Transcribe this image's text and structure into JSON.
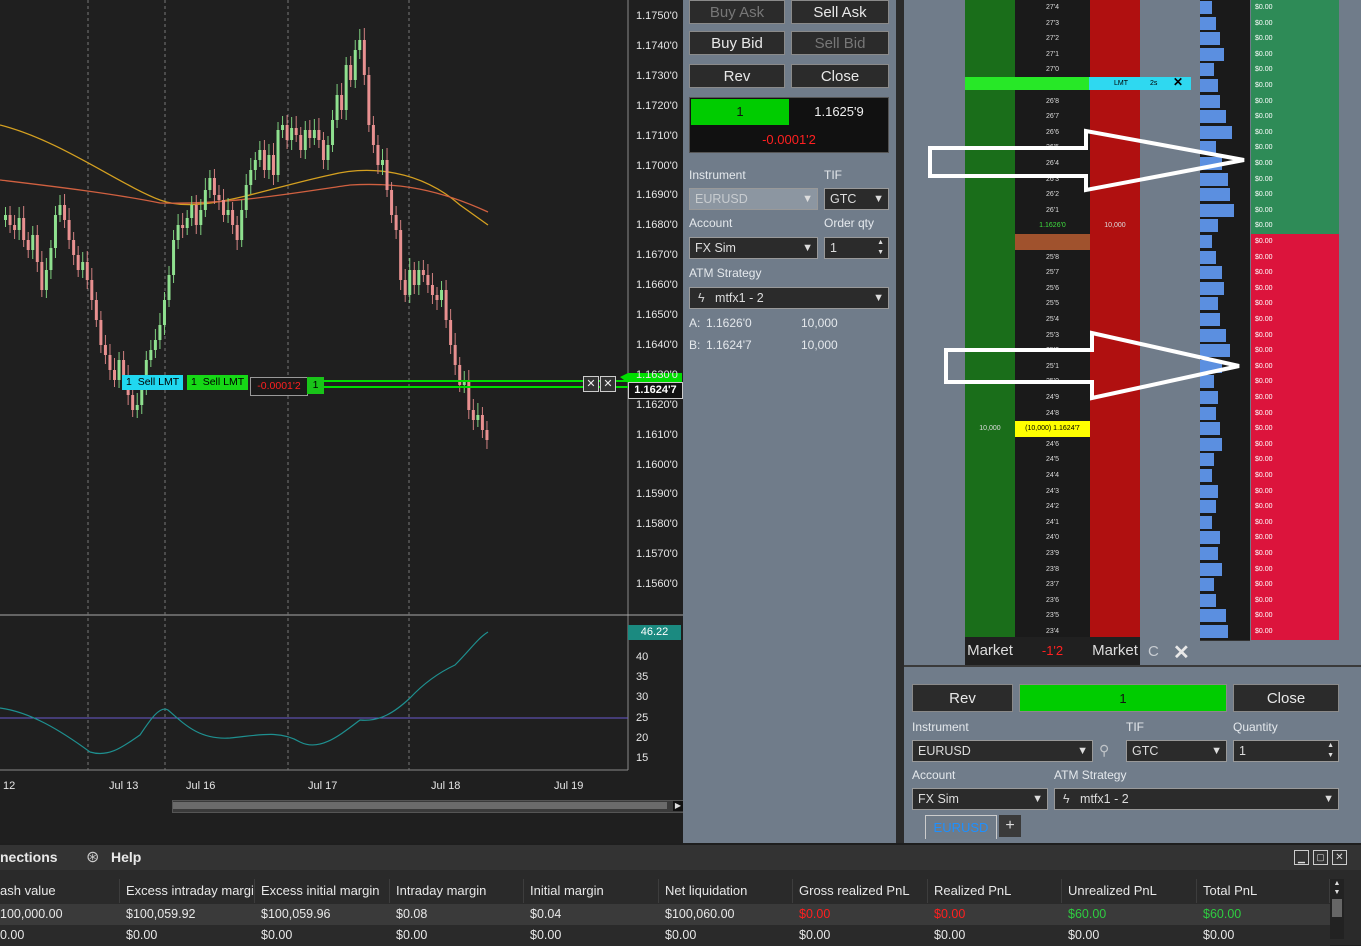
{
  "chart": {
    "price_labels": [
      "1.1750'0",
      "1.1740'0",
      "1.1730'0",
      "1.1720'0",
      "1.1710'0",
      "1.1700'0",
      "1.1690'0",
      "1.1680'0",
      "1.1670'0",
      "1.1660'0",
      "1.1650'0",
      "1.1640'0",
      "1.1630'0",
      "1.1620'0",
      "1.1610'0",
      "1.1600'0",
      "1.1590'0",
      "1.1580'0",
      "1.1570'0",
      "1.1560'0"
    ],
    "osc_labels": [
      "40",
      "35",
      "30",
      "25",
      "20",
      "15"
    ],
    "date_labels": [
      "12",
      "Jul 13",
      "Jul 16",
      "Jul 17",
      "Jul 18",
      "Jul 19"
    ],
    "current_price": "1.1624'7",
    "osc_value": "46.22",
    "order_qty1": "1",
    "order_label1": "Sell LMT",
    "order_qty2": "1",
    "order_label2": "Sell LMT",
    "pnl": "-0.0001'2",
    "pos_qty": "1"
  },
  "order_entry": {
    "buy_ask": "Buy Ask",
    "sell_ask": "Sell Ask",
    "buy_bid": "Buy Bid",
    "sell_bid": "Sell Bid",
    "rev": "Rev",
    "close": "Close",
    "position_qty": "1",
    "avg_price": "1.1625'9",
    "pnl": "-0.0001'2",
    "instrument_label": "Instrument",
    "instrument_value": "EURUSD",
    "tif_label": "TIF",
    "tif_value": "GTC",
    "account_label": "Account",
    "account_value": "FX Sim",
    "order_qty_label": "Order qty",
    "order_qty_value": "1",
    "atm_label": "ATM Strategy",
    "atm_value": "mtfx1 - 2",
    "ask_label": "A:",
    "ask_price": "1.1626'0",
    "ask_size": "10,000",
    "bid_label": "B:",
    "bid_price": "1.1624'7",
    "bid_size": "10,000"
  },
  "dom": {
    "prices": [
      "27'4",
      "27'3",
      "27'2",
      "27'1",
      "27'0",
      "26'9",
      "26'8",
      "26'7",
      "26'6",
      "26'5",
      "26'4",
      "26'3",
      "26'2",
      "26'1",
      "1.1626'0",
      "25'9",
      "25'8",
      "25'7",
      "25'6",
      "25'5",
      "25'4",
      "25'3",
      "25'2",
      "25'1",
      "25'0",
      "24'9",
      "24'8",
      "(10,000) 1.1624'7",
      "24'6",
      "24'5",
      "24'4",
      "24'3",
      "24'2",
      "24'1",
      "24'0",
      "23'9",
      "23'8",
      "23'7",
      "23'6",
      "23'5",
      "23'4"
    ],
    "pnl_cell": "$0.00",
    "ask_size_at_inside": "10,000",
    "bid_size_at_inside": "10,000",
    "lmt_tag": "LMT",
    "lmt_count": "2s",
    "market_left": "Market",
    "center_value": "-1'2",
    "market_right": "Market",
    "c_label": "C",
    "rev": "Rev",
    "position_qty": "1",
    "close": "Close",
    "instrument_label": "Instrument",
    "instrument_value": "EURUSD",
    "tif_label": "TIF",
    "tif_value": "GTC",
    "quantity_label": "Quantity",
    "quantity_value": "1",
    "account_label": "Account",
    "account_value": "FX Sim",
    "atm_label": "ATM Strategy",
    "atm_value": "mtfx1 - 2",
    "tab": "EURUSD",
    "add_tab": "+"
  },
  "bottom": {
    "menu_connections": "nections",
    "menu_help": "Help",
    "columns": [
      "ash value",
      "Excess intraday margi",
      "Excess initial margin",
      "Intraday margin",
      "Initial margin",
      "Net liquidation",
      "Gross realized PnL",
      "Realized PnL",
      "Unrealized PnL",
      "Total PnL"
    ],
    "row1": [
      "100,000.00",
      "$100,059.92",
      "$100,059.96",
      "$0.08",
      "$0.04",
      "$100,060.00",
      "$0.00",
      "$0.00",
      "$60.00",
      "$60.00"
    ],
    "row2": [
      "0.00",
      "$0.00",
      "$0.00",
      "$0.00",
      "$0.00",
      "$0.00",
      "$0.00",
      "$0.00",
      "$0.00",
      "$0.00"
    ]
  },
  "colors": {
    "green": "#00cc00",
    "red_pnl": "#ff2020",
    "ask_col": "#b01010",
    "bid_col": "#1a6e1a",
    "pnl_green": "#2e8b57",
    "pnl_red": "#dc143c",
    "volume_bar": "#5b8fe0"
  }
}
